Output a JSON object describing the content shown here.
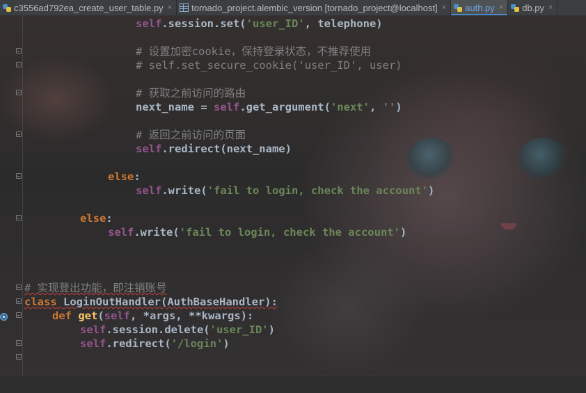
{
  "tabs": [
    {
      "icon": "python-file-icon",
      "label": "c3556ad792ea_create_user_table.py",
      "active": false
    },
    {
      "icon": "table-icon",
      "label": "tornado_project.alembic_version [tornado_project@localhost]",
      "active": false
    },
    {
      "icon": "python-file-icon",
      "label": "auth.py",
      "active": true
    },
    {
      "icon": "python-file-icon",
      "label": "db.py",
      "active": false
    }
  ],
  "tab_close_glyph": "×",
  "editor": {
    "colors": {
      "self": "#94558d",
      "string": "#6a8759",
      "keyword": "#cc7832",
      "function": "#ffc66d",
      "comment": "#808080",
      "default": "#a9b7c6"
    },
    "code": {
      "l1_self": "self",
      "l1_rest": ".session.set(",
      "l1_str": "'user_ID'",
      "l1_end": ", telephone)",
      "l3_comment": "# 设置加密cookie，保持登录状态，不推荐使用",
      "l4_comment": "# self.set_secure_cookie('user_ID', user)",
      "l6_comment": "# 获取之前访问的路由",
      "l7_a": "next_name = ",
      "l7_self": "self",
      "l7_b": ".get_argument(",
      "l7_str1": "'next'",
      "l7_c": ", ",
      "l7_str2": "''",
      "l7_d": ")",
      "l9_comment": "# 返回之前访问的页面",
      "l10_self": "self",
      "l10_rest": ".redirect(next_name)",
      "l12_kw": "else",
      "l12_colon": ":",
      "l13_self": "self",
      "l13_a": ".write(",
      "l13_str": "'fail to login, check the account'",
      "l13_b": ")",
      "l15_kw": "else",
      "l15_colon": ":",
      "l16_self": "self",
      "l16_a": ".write(",
      "l16_str": "'fail to login, check the account'",
      "l16_b": ")",
      "l20_comment": "# 实现登出功能，即注销账号",
      "l21_kw": "class",
      "l21_name": "LoginOutHandler",
      "l21_rest": "(AuthBaseHandler):",
      "l22_kw": "def",
      "l22_fn": "get",
      "l22_a": "(",
      "l22_self": "self",
      "l22_rest": ", *args, **kwargs):",
      "l23_self": "self",
      "l23_a": ".session.delete(",
      "l23_str": "'user_ID'",
      "l23_b": ")",
      "l24_self": "self",
      "l24_a": ".redirect(",
      "l24_str": "'/login'",
      "l24_b": ")"
    }
  }
}
